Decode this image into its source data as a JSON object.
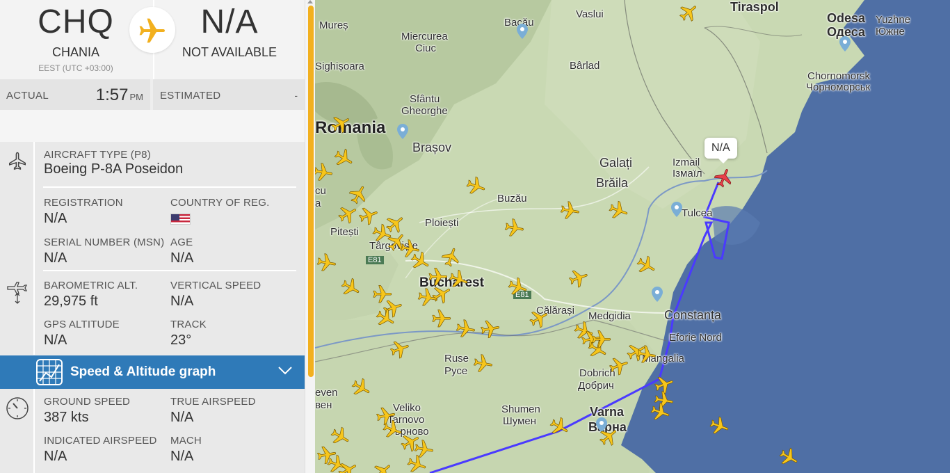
{
  "route": {
    "origin": {
      "iata": "CHQ",
      "city": "CHANIA",
      "timezone": "EEST (UTC +03:00)"
    },
    "destination": {
      "iata": "N/A",
      "city": "NOT AVAILABLE"
    }
  },
  "times": {
    "actual_label": "ACTUAL",
    "actual_time": "1:57",
    "actual_ampm": "PM",
    "estimated_label": "ESTIMATED",
    "estimated_value": "-"
  },
  "aircraft": {
    "type_label": "AIRCRAFT TYPE (P8)",
    "type_value": "Boeing P-8A Poseidon",
    "registration_label": "REGISTRATION",
    "registration_value": "N/A",
    "country_label": "COUNTRY OF REG.",
    "country_flag": "us-flag-icon",
    "serial_label": "SERIAL NUMBER (MSN)",
    "serial_value": "N/A",
    "age_label": "AGE",
    "age_value": "N/A"
  },
  "altitude": {
    "baro_label": "BAROMETRIC ALT.",
    "baro_value": "29,975 ft",
    "vspeed_label": "VERTICAL SPEED",
    "vspeed_value": "N/A",
    "gps_label": "GPS ALTITUDE",
    "gps_value": "N/A",
    "track_label": "TRACK",
    "track_value": "23°"
  },
  "graph_bar": {
    "label": "Speed & Altitude graph",
    "icon": "graph-icon"
  },
  "speed": {
    "ground_label": "GROUND SPEED",
    "ground_value": "387 kts",
    "tas_label": "TRUE AIRSPEED",
    "tas_value": "N/A",
    "ias_label": "INDICATED AIRSPEED",
    "ias_value": "N/A",
    "mach_label": "MACH",
    "mach_value": "N/A"
  },
  "map": {
    "selected_callout": "N/A",
    "labels": {
      "tirgu_mures": "Mureș",
      "bacau": "Bacău",
      "vaslui": "Vaslui",
      "tiraspol": "Tiraspol",
      "odesa": "Odesa",
      "odesa_cyr": "Одеса",
      "yuzhne": "Yuzhne",
      "yuzhne_cyr": "Южне",
      "miercurea_1": "Miercurea",
      "miercurea_2": "Ciuc",
      "sighisoara": "Sighișoara",
      "barlad": "Bârlad",
      "chornomorsk": "Chornomorsk",
      "chornomorsk_cyr": "Чорноморськ",
      "sfantu_1": "Sfântu",
      "sfantu_2": "Gheorghe",
      "romania": "Romania",
      "brasov": "Brașov",
      "galati": "Galați",
      "braila": "Brăila",
      "izmail": "Izmail",
      "izmail_cyr": "Ізмаїл",
      "buzau": "Buzău",
      "tulcea": "Tulcea",
      "pitesti": "Pitești",
      "ploiesti": "Ploiești",
      "targoviste": "Târgoviște",
      "bucharest": "Bucharest",
      "e81_a": "E81",
      "e81_b": "E81",
      "calarasi": "Călărași",
      "medgidia": "Medgidia",
      "constanta": "Constanța",
      "eforie": "Eforie Nord",
      "mangalia": "Mangalia",
      "ruse": "Ruse",
      "ruse_cyr": "Русе",
      "dobrich": "Dobrich",
      "dobrich_cyr": "Добрич",
      "veliko_1": "Veliko",
      "veliko_2": "Tarnovo",
      "veliko_3": "Търново",
      "shumen": "Shumen",
      "shumen_cyr": "Шумен",
      "varna": "Varna",
      "varna_cyr": "Варна",
      "pleven": "even",
      "pleven_cyr": "вен",
      "ramnicu": "cu",
      "ramnicu_2": "a"
    }
  },
  "colors": {
    "accent_yellow": "#f2b01e",
    "graph_bar_blue": "#2f7ab8",
    "flight_path": "#4a3aff",
    "selected_plane": "#e8404a",
    "sea": "#4f6fa5"
  }
}
